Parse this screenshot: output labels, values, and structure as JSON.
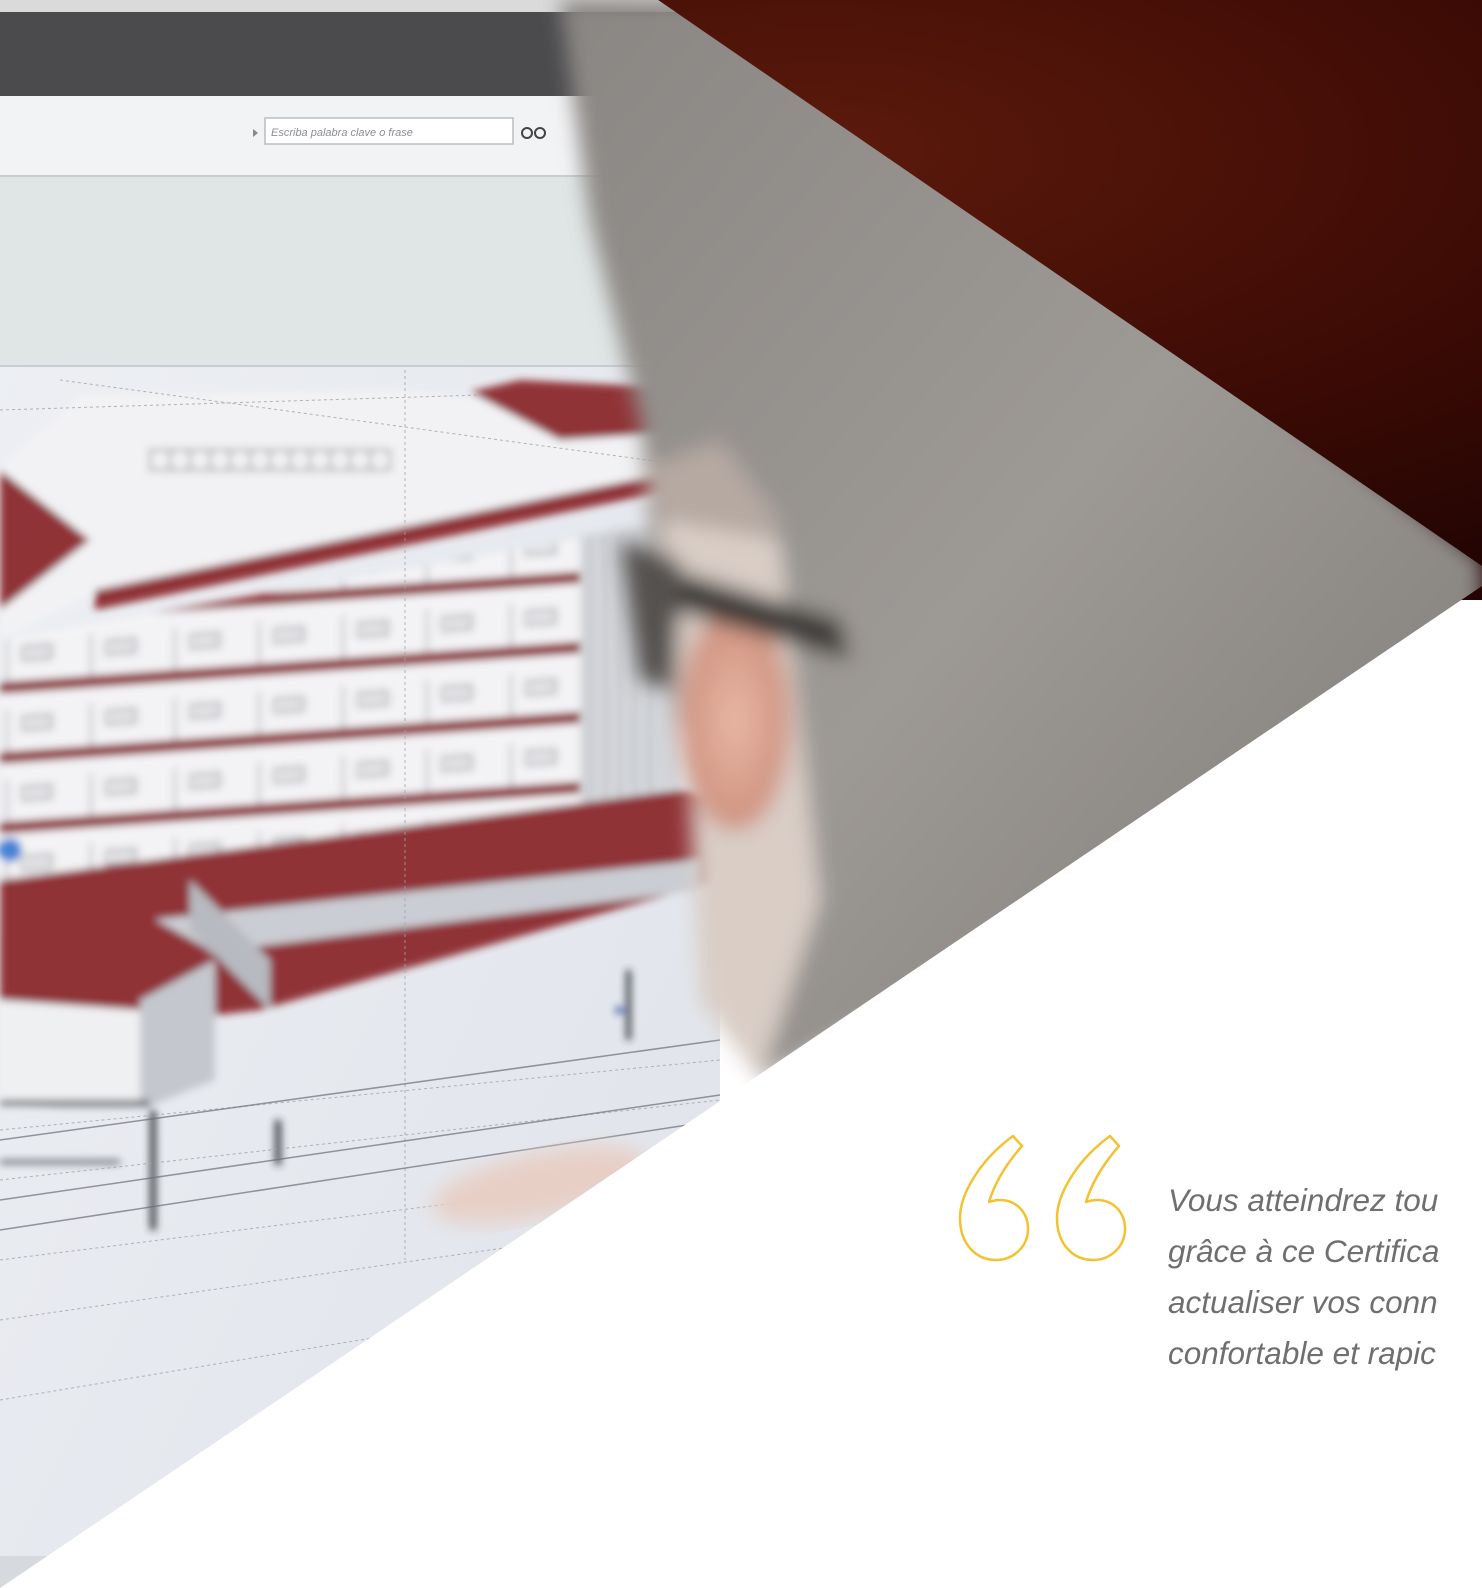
{
  "photo": {
    "search_placeholder": "Escriba palabra clave o frase",
    "icon": "binoculars-icon"
  },
  "quote": {
    "icon": "quote-open-icon",
    "accent_color": "#f2c230",
    "lines": [
      "Vous atteindrez tou",
      "grâce à ce Certifica",
      "actualiser vos conn",
      "confortable et rapic"
    ]
  },
  "colors": {
    "background": "#ffffff",
    "dark_backdrop": "#3a0a05",
    "building_roof": "#8c2a2e",
    "text": "#6f6f6f"
  }
}
